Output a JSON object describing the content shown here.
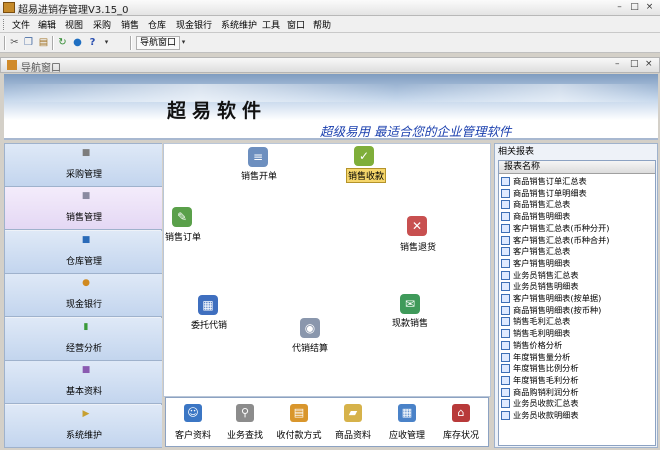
{
  "window": {
    "title": "超易进销存管理V3.15_0",
    "controls": [
      "–",
      "□",
      "×"
    ]
  },
  "menubar": {
    "items": [
      "文件",
      "编辑",
      "视图",
      "采购",
      "销售",
      "仓库",
      "现金银行",
      "系统维护",
      "工具",
      "窗口",
      "帮助"
    ]
  },
  "toolbar": {
    "icons": [
      "cut-icon",
      "copy-icon",
      "paste-icon",
      "refresh-icon",
      "globe-icon",
      "help-icon"
    ],
    "nav_window_label": "导航窗口"
  },
  "nav_window": {
    "title": "导航窗口",
    "controls": [
      "–",
      "□",
      "×"
    ]
  },
  "banner": {
    "brand": "超易软件",
    "slogan": "超级易用 最适合您的企业管理软件"
  },
  "sidebar": {
    "items": [
      {
        "label": "采购管理",
        "icon": "purchase-icon"
      },
      {
        "label": "销售管理",
        "icon": "sales-icon",
        "selected": true
      },
      {
        "label": "仓库管理",
        "icon": "warehouse-icon"
      },
      {
        "label": "现金银行",
        "icon": "cash-icon"
      },
      {
        "label": "经营分析",
        "icon": "analysis-icon"
      },
      {
        "label": "基本资料",
        "icon": "basic-info-icon"
      },
      {
        "label": "系统维护",
        "icon": "maintenance-icon"
      }
    ]
  },
  "workflow": {
    "items": [
      {
        "label": "销售开单",
        "icon": "sales-invoice-icon"
      },
      {
        "label": "销售收款",
        "icon": "sales-receipt-icon",
        "highlighted": true
      },
      {
        "label": "销售订单",
        "icon": "sales-order-icon"
      },
      {
        "label": "销售退货",
        "icon": "sales-return-icon"
      },
      {
        "label": "委托代销",
        "icon": "consignment-icon"
      },
      {
        "label": "现款销售",
        "icon": "cash-sales-icon"
      },
      {
        "label": "代销结算",
        "icon": "consignment-settle-icon"
      }
    ]
  },
  "quickbar": {
    "items": [
      {
        "label": "客户资料",
        "icon": "customer-icon"
      },
      {
        "label": "业务查找",
        "icon": "search-icon"
      },
      {
        "label": "收付款方式",
        "icon": "payment-method-icon"
      },
      {
        "label": "商品资料",
        "icon": "product-icon"
      },
      {
        "label": "应收管理",
        "icon": "receivable-icon"
      },
      {
        "label": "库存状况",
        "icon": "inventory-icon"
      }
    ]
  },
  "reports": {
    "title": "相关报表",
    "column_header": "报表名称",
    "items": [
      "商品销售订单汇总表",
      "商品销售订单明细表",
      "商品销售汇总表",
      "商品销售明细表",
      "客户销售汇总表(币种分开)",
      "客户销售汇总表(币种合并)",
      "客户销售汇总表",
      "客户销售明细表",
      "业务员销售汇总表",
      "业务员销售明细表",
      "客户销售明细表(按单据)",
      "商品销售明细表(按币种)",
      "销售毛利汇总表",
      "销售毛利明细表",
      "销售价格分析",
      "年度销售量分析",
      "年度销售比例分析",
      "年度销售毛利分析",
      "商品购销利润分析",
      "业务员收款汇总表",
      "业务员收款明细表"
    ]
  },
  "colors": {
    "sidebar_gradient_top": "#dfe9f7",
    "sidebar_gradient_bottom": "#c3d5ee",
    "selected_item": "#e4d8f4",
    "slogan_blue": "#1a3fae",
    "highlight_label": "#f6d66a"
  }
}
